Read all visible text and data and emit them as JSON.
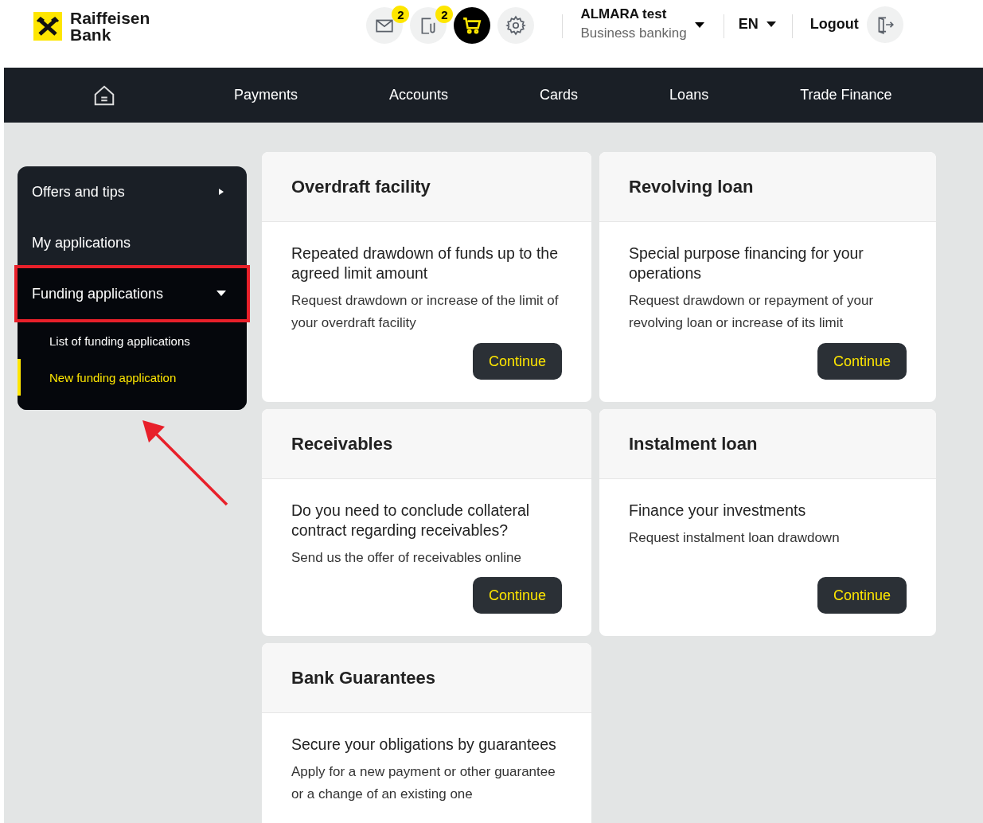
{
  "header": {
    "logo": "Raiffeisen\nBank",
    "icons": [
      {
        "kind": "mail",
        "badge": "2",
        "selected": false
      },
      {
        "kind": "document",
        "badge": "2",
        "selected": false
      },
      {
        "kind": "cart",
        "selected": true
      },
      {
        "kind": "settings",
        "selected": false
      }
    ],
    "user": {
      "name": "ALMARA test",
      "subtitle": "Business banking"
    },
    "language": "EN",
    "logout": "Logout"
  },
  "nav": [
    "Payments",
    "Accounts",
    "Cards",
    "Loans",
    "Trade Finance"
  ],
  "sidebar": {
    "items": [
      {
        "label": "Offers and tips",
        "kind": "menu",
        "expanded": false,
        "highlighted": false
      },
      {
        "label": "My applications",
        "kind": "link",
        "highlighted": false
      },
      {
        "label": "Funding applications",
        "kind": "menu",
        "expanded": true,
        "highlighted": true,
        "children": [
          {
            "label": "List of funding applications",
            "selected": false
          },
          {
            "label": "New funding application",
            "selected": true
          }
        ]
      }
    ]
  },
  "cards": [
    {
      "title": "Overdraft facility",
      "heading": "Repeated drawdown of funds up to the agreed limit amount",
      "description": "Request drawdown or increase of the limit of your overdraft facility",
      "button": "Continue"
    },
    {
      "title": "Revolving loan",
      "heading": "Special purpose financing for your operations",
      "description": "Request drawdown or repayment of your revolving loan or increase of its limit",
      "button": "Continue"
    },
    {
      "title": "Receivables",
      "heading": "Do you need to conclude collateral contract regarding receivables?",
      "description": "Send us the offer of receivables online",
      "button": "Continue"
    },
    {
      "title": "Instalment loan",
      "heading": "Finance your investments",
      "description": "Request instalment loan drawdown",
      "button": "Continue"
    },
    {
      "title": "Bank Guarantees",
      "heading": "Secure your obligations by guarantees",
      "description": "Apply for a new payment or other guarantee or a change of an existing one"
    }
  ]
}
